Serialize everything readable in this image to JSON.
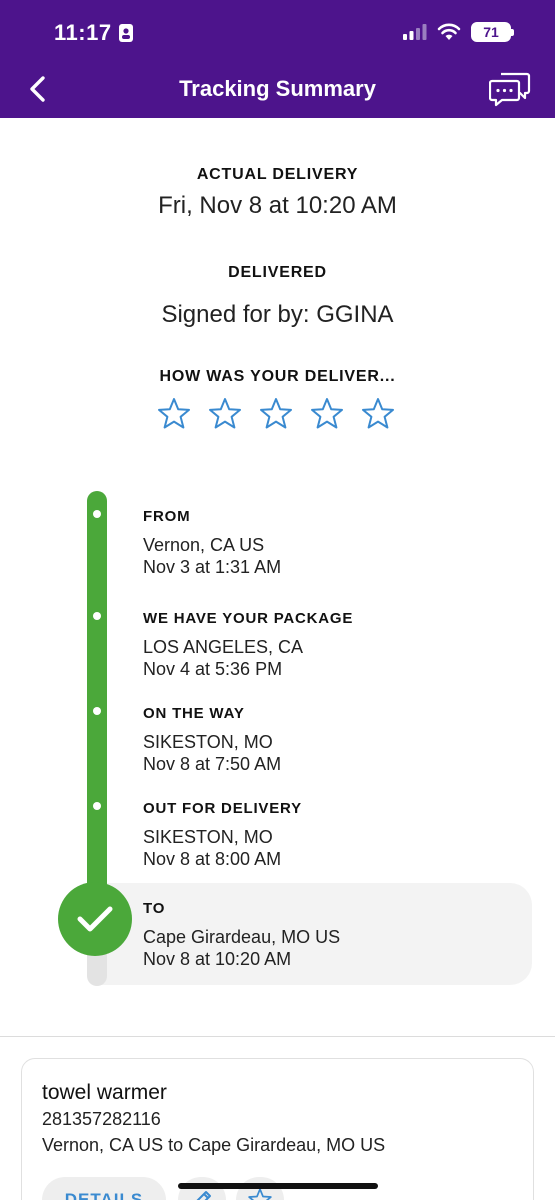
{
  "status_bar": {
    "time": "11:17",
    "battery": "71"
  },
  "nav": {
    "title": "Tracking Summary",
    "back_icon": "chevron-left-icon",
    "chat_icon": "chat-bubbles-icon",
    "bar_color": "#4d148c"
  },
  "delivery": {
    "actual_label": "ACTUAL DELIVERY",
    "actual_value": "Fri, Nov 8 at 10:20 AM",
    "status_label": "DELIVERED",
    "signed_text": "Signed for by: GGINA"
  },
  "rating": {
    "prompt": "HOW WAS YOUR DELIVER...",
    "max_stars": 5,
    "selected": 0,
    "star_color": "#3a8ad0"
  },
  "timeline": {
    "progress_color": "#4ba83a",
    "stops": [
      {
        "label": "FROM",
        "line1": "Vernon, CA US",
        "line2": "Nov 3 at 1:31 AM"
      },
      {
        "label": "WE HAVE YOUR PACKAGE",
        "line1": "LOS ANGELES, CA",
        "line2": "Nov 4 at 5:36 PM"
      },
      {
        "label": "ON THE WAY",
        "line1": "SIKESTON, MO",
        "line2": "Nov 8 at 7:50 AM"
      },
      {
        "label": "OUT FOR DELIVERY",
        "line1": "SIKESTON, MO",
        "line2": "Nov 8 at 8:00 AM"
      },
      {
        "label": "TO",
        "line1": "Cape Girardeau, MO US",
        "line2": "Nov 8 at 10:20 AM"
      }
    ]
  },
  "shipment": {
    "name": "towel warmer",
    "tracking_number": "281357282116",
    "route": "Vernon, CA US to Cape Girardeau, MO US",
    "details_button": "DETAILS",
    "edit_icon": "pencil-icon",
    "watch_icon": "star-icon"
  }
}
